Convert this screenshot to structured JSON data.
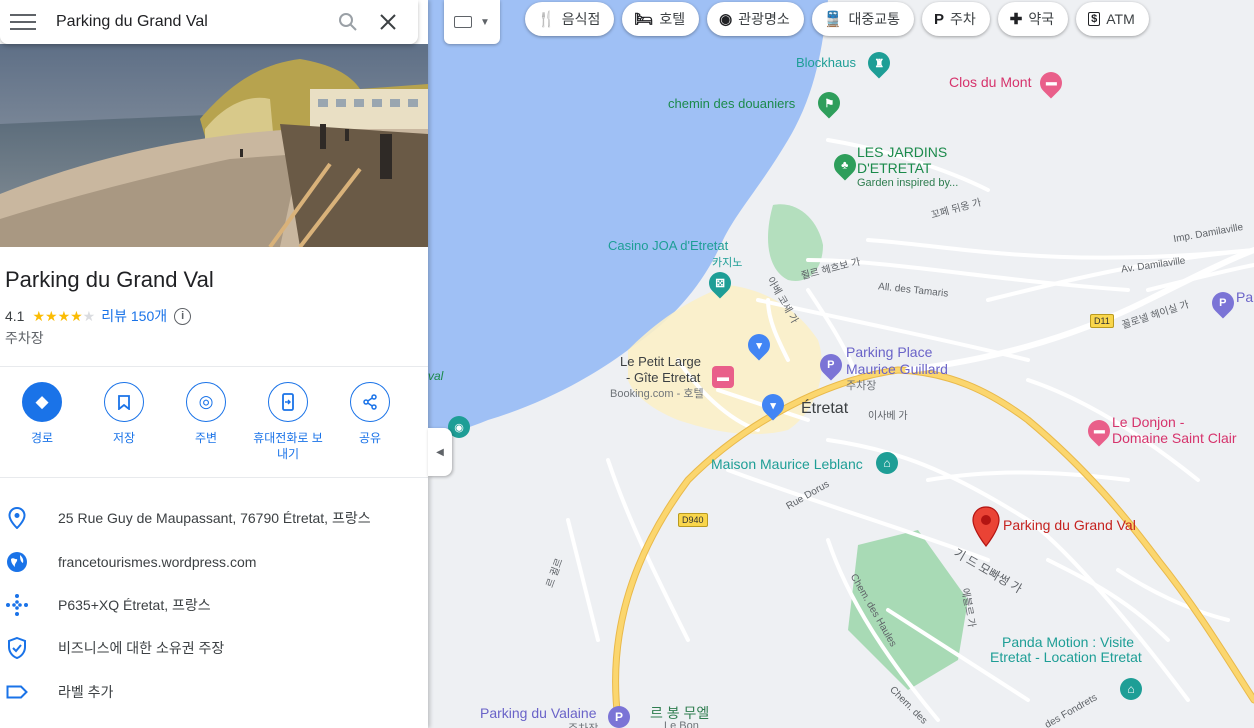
{
  "search": {
    "value": "Parking du Grand Val"
  },
  "place": {
    "title": "Parking du Grand Val",
    "rating": "4.1",
    "stars_filled": 4,
    "reviews": "리뷰 150개",
    "category": "주차장"
  },
  "actions": [
    {
      "label": "경로",
      "icon": "directions-icon"
    },
    {
      "label": "저장",
      "icon": "bookmark-icon"
    },
    {
      "label": "주변",
      "icon": "nearby-icon"
    },
    {
      "label": "휴대전화로 보\n내기",
      "icon": "send-to-phone-icon"
    },
    {
      "label": "공유",
      "icon": "share-icon"
    }
  ],
  "info": {
    "address": "25 Rue Guy de Maupassant, 76790 Étretat, 프랑스",
    "website": "francetourismes.wordpress.com",
    "plus_code": "P635+XQ Étretat, 프랑스",
    "claim": "비즈니스에 대한 소유권 주장",
    "label": "라벨 추가"
  },
  "chips": [
    {
      "label": "음식점",
      "icon": "🍴"
    },
    {
      "label": "호텔",
      "icon": "🛏"
    },
    {
      "label": "관광명소",
      "icon": "◉"
    },
    {
      "label": "대중교통",
      "icon": "🚆"
    },
    {
      "label": "주차",
      "icon": "P"
    },
    {
      "label": "약국",
      "icon": "✚"
    },
    {
      "label": "ATM",
      "icon": "$"
    }
  ],
  "map": {
    "blockhaus": "Blockhaus",
    "clos_du_mont": "Clos du Mont",
    "chemin": "chemin des douaniers",
    "jardins_1": "LES JARDINS",
    "jardins_2": "D'ETRETAT",
    "jardins_sub": "Garden inspired by...",
    "casino_1": "Casino JOA d'Etretat",
    "casino_2": "카지노",
    "petit_large_1": "Le Petit Large",
    "petit_large_2": "- Gîte Etretat",
    "petit_large_3": "Booking.com - 호텔",
    "parking_place_1": "Parking Place",
    "parking_place_2": "Maurice Guillard",
    "parking_place_3": "주차장",
    "etretat": "Étretat",
    "donjon_1": "Le Donjon -",
    "donjon_2": "Domaine Saint Clair",
    "maison_leblanc": "Maison Maurice Leblanc",
    "selected": "Parking du Grand Val",
    "panda_1": "Panda Motion : Visite",
    "panda_2": "Etretat - Location Etretat",
    "parking_valaine": "Parking du Valaine",
    "valaine_sub": "주차장",
    "bon_1": "르 봉 무엘",
    "bon_2": "Le Bon",
    "road_kkopet": "꼬페 뒤옹 가",
    "road_damilaville": "Imp. Damilaville",
    "road_av_damilaville": "Av. Damilaville",
    "road_tamaris": "All. des Tamaris",
    "road_jules": "쥘르 헤흐보 가",
    "road_abbe": "아베 코셰 가",
    "road_isabey": "이사베 가",
    "road_dorus": "Rue Dorus",
    "road_guy": "기 드 모빠썽 가",
    "road_haules": "Chem. des Haules",
    "road_haules2": "Chem. des",
    "road_fondrets": "des Fondrets",
    "road_gurel": "르 귈르",
    "road_paul": "꼴로넬 헤이실 가",
    "road_ebr": "에블르 가",
    "d11": "D11",
    "d940": "D940",
    "val": "val",
    "pa": "Pa"
  },
  "colors": {
    "accent": "#1a73e8",
    "water": "#aac8f7",
    "town": "#fbf3d1",
    "park": "#a8dab5",
    "road_major": "#f6c343"
  }
}
